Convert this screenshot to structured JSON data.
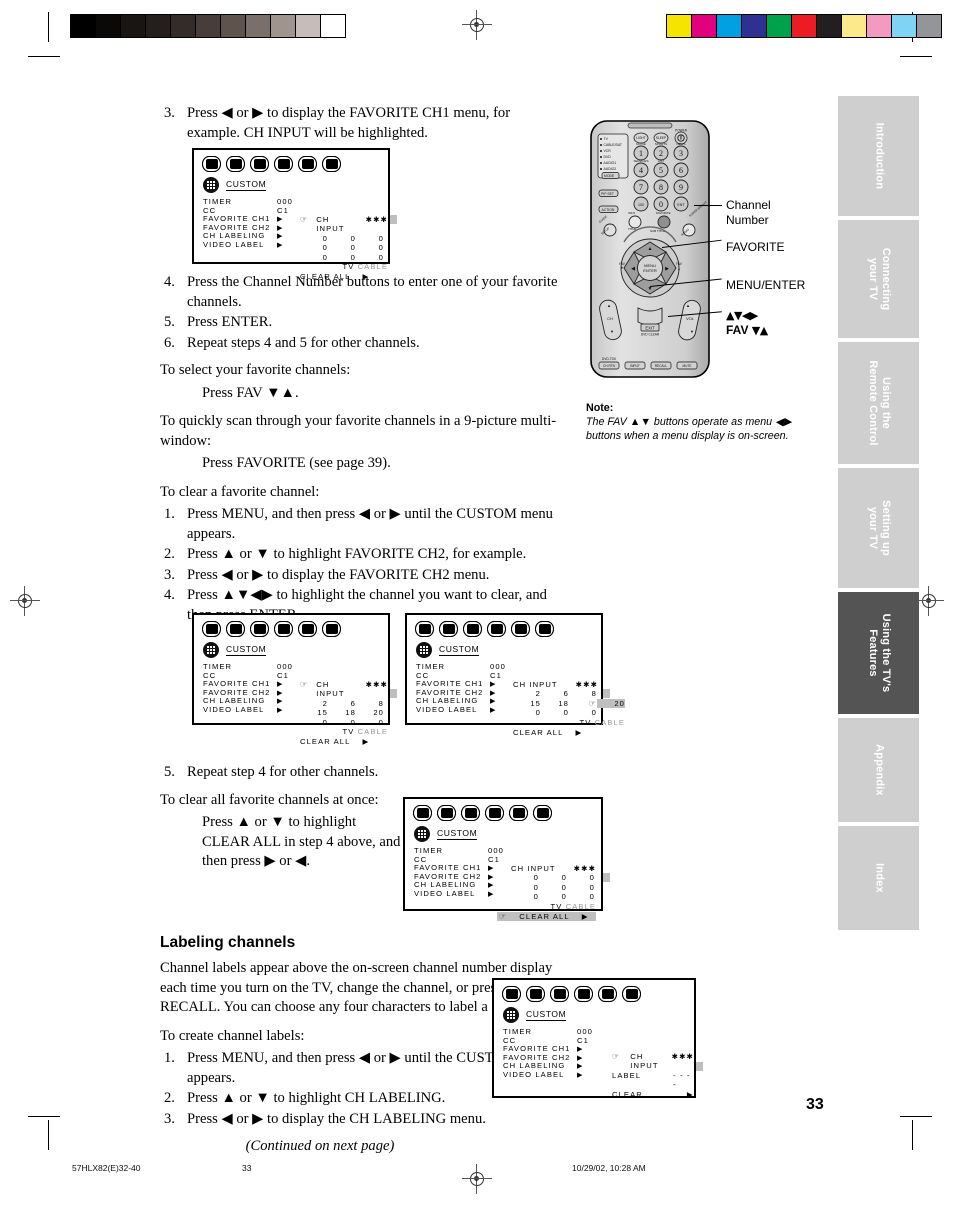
{
  "document": {
    "page_number": "33",
    "footer_left": "57HLX82(E)32-40",
    "footer_center": "33",
    "footer_right": "10/29/02, 10:28 AM"
  },
  "side_tabs": [
    {
      "label": "Introduction",
      "active": false
    },
    {
      "label": "Connecting\nyour TV",
      "active": false
    },
    {
      "label": "Using the\nRemote Control",
      "active": false
    },
    {
      "label": "Setting up\nyour TV",
      "active": false
    },
    {
      "label": "Using the TV's\nFeatures",
      "active": true
    },
    {
      "label": "Appendix",
      "active": false
    },
    {
      "label": "Index",
      "active": false
    }
  ],
  "content": {
    "step3_num": "3.",
    "step3_text": "Press ◀ or ▶ to display the FAVORITE CH1 menu, for example. CH INPUT will be highlighted.",
    "step4_num": "4.",
    "step4_text": "Press the Channel Number buttons to enter one of your favorite channels.",
    "step5_num": "5.",
    "step5_text": "Press ENTER.",
    "step6_num": "6.",
    "step6_text": "Repeat steps 4 and 5 for other channels.",
    "select_heading": "To select your favorite channels:",
    "select_body": "Press FAV ▼▲.",
    "scan_heading": "To quickly scan through your favorite channels in a 9-picture multi-window:",
    "scan_body": "Press FAVORITE (see  page 39).",
    "clear_heading": "To clear a favorite channel:",
    "clear_steps": [
      {
        "n": "1.",
        "t": "Press MENU, and then press ◀ or ▶ until the CUSTOM menu appears."
      },
      {
        "n": "2.",
        "t": "Press ▲ or ▼ to highlight FAVORITE CH2, for example."
      },
      {
        "n": "3.",
        "t": "Press ◀ or ▶ to display the FAVORITE CH2 menu."
      },
      {
        "n": "4.",
        "t": "Press ▲▼◀▶ to highlight the channel you want to clear, and then press ENTER."
      }
    ],
    "clear_step5_num": "5.",
    "clear_step5_text": "Repeat step 4 for other channels.",
    "clear_all_heading": "To clear all favorite channels at once:",
    "clear_all_body": "Press ▲ or ▼ to highlight CLEAR ALL in step 4 above, and then press ▶ or ◀.",
    "labeling_title": "Labeling channels",
    "labeling_intro": "Channel labels appear above the on-screen channel number display each time you turn on the TV, change the channel, or press RECALL. You can choose any four characters to label a channel.",
    "labeling_heading": "To create channel labels:",
    "labeling_steps": [
      {
        "n": "1.",
        "t": "Press MENU, and then press ◀ or ▶ until the CUSTOM menu appears."
      },
      {
        "n": "2.",
        "t": "Press ▲ or ▼ to highlight CH LABELING."
      },
      {
        "n": "3.",
        "t": "Press ◀ or ▶ to display the CH LABELING menu."
      }
    ],
    "continued": "(Continued on next page)"
  },
  "note": {
    "title": "Note:",
    "line1": "The FAV ▲▼ buttons operate as menu ◀▶",
    "line2": "buttons when a menu display is on-screen."
  },
  "remote": {
    "callouts": [
      {
        "label": "Channel\nNumber"
      },
      {
        "label": "FAVORITE"
      },
      {
        "label": "MENU/ENTER"
      },
      {
        "label": "▲▼◀▶\nFAV ▼▲"
      }
    ],
    "mode_labels": [
      "TV",
      "CABLE/SAT",
      "VCR",
      "DVD",
      "AUDIO1",
      "AUDIO2"
    ],
    "mode_button": "MODE",
    "side_buttons": [
      "PIP SET",
      "ACTION"
    ],
    "top_buttons": [
      "LIGHT",
      "SLEEP",
      "POWER"
    ],
    "keypad": [
      "1",
      "2",
      "3",
      "4",
      "5",
      "6",
      "7",
      "8",
      "9",
      "100",
      "0",
      "ENT"
    ],
    "keypad_sub": [
      "MOVIE",
      "SPORTS",
      "NEWS",
      "SERVICES",
      "LIST"
    ],
    "mid_buttons": [
      "GUIDE",
      "INFO",
      "FAVORITE",
      "SUPER BRIGHT"
    ],
    "mid_sub": [
      "SETUP",
      "TITLE",
      "SUB TITLE",
      "AUDIO"
    ],
    "wheel": [
      "MENU\nENTER",
      "FAV ▼",
      "FAV ▲"
    ],
    "rockers": [
      "CH",
      "VOL"
    ],
    "bottom_buttons": [
      "DVD-TDK CH RTN",
      "INPUT",
      "RECALL",
      "MUTE"
    ],
    "exit_label": "EXIT",
    "exit_sub": "DVD CLEAR"
  },
  "osd_common": {
    "menu_icon_count": 6,
    "custom_label": "CUSTOM",
    "rows": [
      "TIMER",
      "CC",
      "FAVORITE CH1",
      "FAVORITE CH2",
      "CH LABELING",
      "VIDEO LABEL"
    ],
    "timer_value": "000",
    "cc_value": "C1",
    "ch_input_label": "CH INPUT",
    "ch_input_stars": "✱✱✱",
    "clear_all_label": "CLEAR ALL",
    "tv_label": "TV",
    "cable_label": "CABLE",
    "arrow": "▶"
  },
  "osd_screens": [
    {
      "id": "osd-favorite-ch1",
      "highlight_row": "FAVORITE CH1",
      "panel": "favorites",
      "grid": [
        [
          "0",
          "0",
          "0"
        ],
        [
          "0",
          "0",
          "0"
        ],
        [
          "0",
          "0",
          "0"
        ]
      ],
      "highlight_cell": null,
      "cursor_on": "CH INPUT",
      "clear_all_highlighted": false
    },
    {
      "id": "osd-favorite-ch2-entered",
      "highlight_row": "FAVORITE CH2",
      "panel": "favorites",
      "grid": [
        [
          "2",
          "6",
          "8"
        ],
        [
          "15",
          "18",
          "20"
        ],
        [
          "0",
          "0",
          "0"
        ]
      ],
      "highlight_cell": null,
      "cursor_on": "CH INPUT",
      "clear_all_highlighted": false
    },
    {
      "id": "osd-favorite-ch2-select-cell",
      "highlight_row": "FAVORITE CH2",
      "panel": "favorites",
      "grid": [
        [
          "2",
          "6",
          "8"
        ],
        [
          "15",
          "18",
          "20"
        ],
        [
          "0",
          "0",
          "0"
        ]
      ],
      "highlight_cell": [
        1,
        2
      ],
      "cursor_on": "cell",
      "clear_all_highlighted": false
    },
    {
      "id": "osd-clear-all",
      "highlight_row": "FAVORITE CH2",
      "panel": "favorites",
      "grid": [
        [
          "0",
          "0",
          "0"
        ],
        [
          "0",
          "0",
          "0"
        ],
        [
          "0",
          "0",
          "0"
        ]
      ],
      "highlight_cell": null,
      "cursor_on": "CLEAR ALL",
      "clear_all_highlighted": true
    },
    {
      "id": "osd-ch-labeling",
      "highlight_row": "CH LABELING",
      "panel": "labeling",
      "labeling": {
        "ch_input": "CH INPUT",
        "stars": "✱✱✱",
        "label_row": "LABEL",
        "label_value": "- - - -",
        "clear_row": "CLEAR",
        "arrow": "▶"
      }
    }
  ],
  "colors": {
    "tab_inactive": "#cfcfcf",
    "tab_active": "#545454",
    "osd_highlight": "#bfbfbf",
    "remote_body": "#d8d8d8"
  },
  "calibration": {
    "gray_bar": [
      "#000000",
      "#0b0908",
      "#191513",
      "#241f1c",
      "#332c28",
      "#473e39",
      "#5e534d",
      "#7b6f69",
      "#9f948e",
      "#c6bdb8",
      "#ffffff"
    ],
    "color_bar": [
      "#f5e400",
      "#e3007f",
      "#00a0e2",
      "#2e3191",
      "#00a14b",
      "#ed1c24",
      "#231f20",
      "#fbe98b",
      "#f49ac1",
      "#7fd4f5",
      "#939598"
    ]
  }
}
